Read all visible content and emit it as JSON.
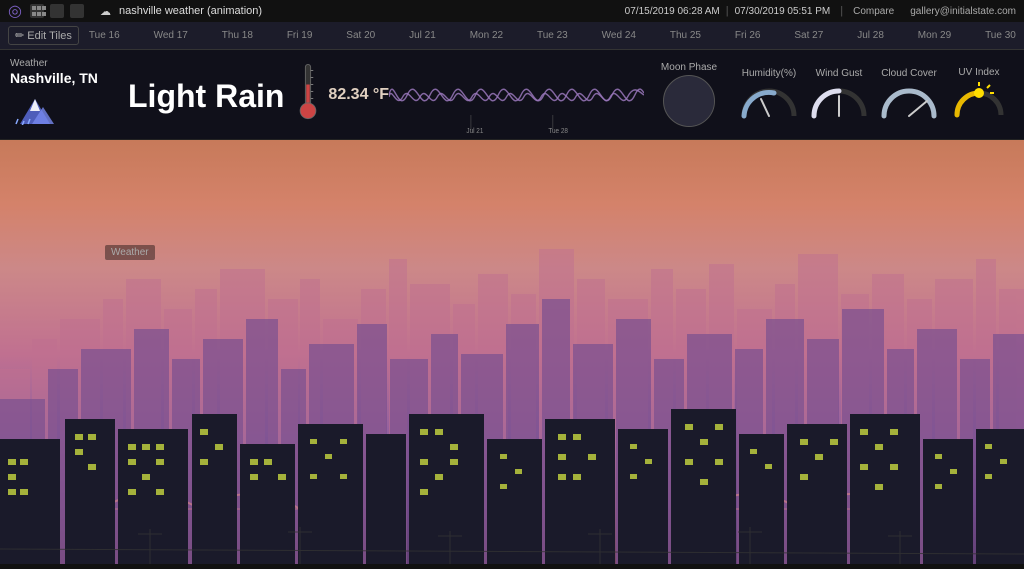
{
  "topbar": {
    "logo_symbol": "◎",
    "title": "nashville weather (animation)",
    "date_start": "07/15/2019 06:28 AM",
    "date_end": "07/30/2019 05:51 PM",
    "compare_label": "Compare",
    "gallery_label": "gallery@initialstate.com"
  },
  "timeline": {
    "edit_tiles": "✏ Edit Tiles",
    "dates": [
      "Tue 16",
      "Wed 17",
      "Thu 18",
      "Fri 19",
      "Sat 20",
      "Jul 21",
      "Mon 22",
      "Tue 23",
      "Wed 24",
      "Thu 25",
      "Fri 26",
      "Sat 27",
      "Jul 28",
      "Mon 29",
      "Tue 30"
    ]
  },
  "widgets": {
    "location": {
      "label": "Weather",
      "city": "Nashville, TN",
      "icon": "🏔️"
    },
    "condition": {
      "text": "Light Rain"
    },
    "temperature": {
      "value": "82.34 °F"
    },
    "moon": {
      "label": "Moon Phase"
    },
    "humidity": {
      "label": "Humidity(%)"
    },
    "wind_gust": {
      "label": "Wind Gust"
    },
    "cloud_cover": {
      "label": "Cloud Cover"
    },
    "uv_index": {
      "label": "UV Index"
    }
  },
  "colors": {
    "accent": "#7a5fc0",
    "background": "#111",
    "strip_bg": "rgba(15,15,25,0.92)"
  }
}
